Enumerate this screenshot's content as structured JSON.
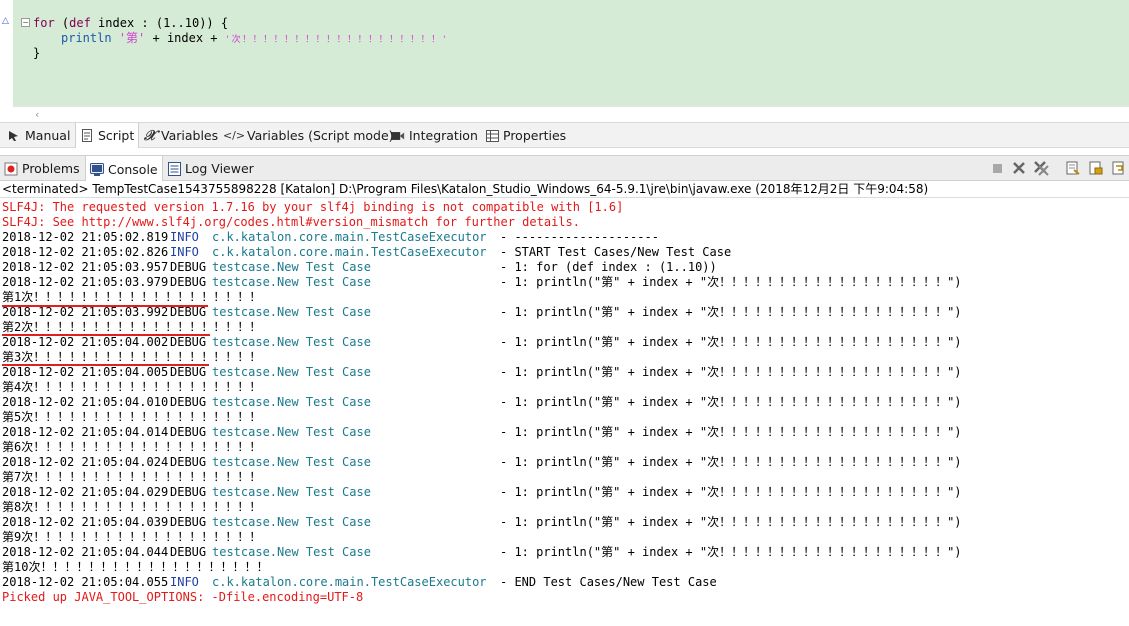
{
  "editor": {
    "line1": {
      "kw_for": "for",
      "p1": " (",
      "kw_def": "def",
      "p2": " index : (1..10)) {"
    },
    "line2": {
      "fn": "println",
      "sp": " ",
      "str1": "'第'",
      "mid": " + index + ",
      "str2": "'次！！！！！！！！！！！！！！！！！！！'"
    },
    "line3": "}"
  },
  "editor_tabs": [
    {
      "label": "Manual",
      "icon": "cursor-icon"
    },
    {
      "label": "Script",
      "icon": "script-icon"
    },
    {
      "label": "Variables",
      "icon": "variable-x-icon"
    },
    {
      "label": "Variables (Script mode)",
      "icon": "code-brackets-icon"
    },
    {
      "label": "Integration",
      "icon": "integration-icon"
    },
    {
      "label": "Properties",
      "icon": "table-icon"
    }
  ],
  "panel_tabs": [
    {
      "label": "Problems",
      "icon": "problems-icon"
    },
    {
      "label": "Console",
      "icon": "console-icon"
    },
    {
      "label": "Log Viewer",
      "icon": "log-viewer-icon"
    }
  ],
  "console_header": "<terminated> TempTestCase1543755898228 [Katalon] D:\\Program Files\\Katalon_Studio_Windows_64-5.9.1\\jre\\bin\\javaw.exe (2018年12月2日 下午9:04:58)",
  "console": {
    "warn1": "SLF4J: The requested version 1.7.16 by your slf4j binding is not compatible with [1.6]",
    "warn2": "SLF4J: See http://www.slf4j.org/codes.html#version_mismatch for further details.",
    "log": [
      {
        "ts": "2018-12-02 21:05:02.819",
        "level": "INFO",
        "src": "c.k.katalon.core.main.TestCaseExecutor",
        "msg": "- --------------------"
      },
      {
        "ts": "2018-12-02 21:05:02.826",
        "level": "INFO",
        "src": "c.k.katalon.core.main.TestCaseExecutor",
        "msg": "- START Test Cases/New Test Case"
      },
      {
        "ts": "2018-12-02 21:05:03.957",
        "level": "DEBUG",
        "src": "testcase.New Test Case",
        "msg": "- 1: for (def index : (1..10))"
      },
      {
        "ts": "2018-12-02 21:05:03.979",
        "level": "DEBUG",
        "src": "testcase.New Test Case",
        "msg": "- 1: println(\"第\" + index + \"次！！！！！！！！！！！！！！！！！！！\")"
      },
      {
        "out": "第1次！！！！！！！！！！！！！！！！！！！"
      },
      {
        "ts": "2018-12-02 21:05:03.992",
        "level": "DEBUG",
        "src": "testcase.New Test Case",
        "msg": "- 1: println(\"第\" + index + \"次！！！！！！！！！！！！！！！！！！！\")"
      },
      {
        "out": "第2次！！！！！！！！！！！！！！！！！！！"
      },
      {
        "ts": "2018-12-02 21:05:04.002",
        "level": "DEBUG",
        "src": "testcase.New Test Case",
        "msg": "- 1: println(\"第\" + index + \"次！！！！！！！！！！！！！！！！！！！\")"
      },
      {
        "out": "第3次！！！！！！！！！！！！！！！！！！！"
      },
      {
        "ts": "2018-12-02 21:05:04.005",
        "level": "DEBUG",
        "src": "testcase.New Test Case",
        "msg": "- 1: println(\"第\" + index + \"次！！！！！！！！！！！！！！！！！！！\")"
      },
      {
        "out": "第4次！！！！！！！！！！！！！！！！！！！"
      },
      {
        "ts": "2018-12-02 21:05:04.010",
        "level": "DEBUG",
        "src": "testcase.New Test Case",
        "msg": "- 1: println(\"第\" + index + \"次！！！！！！！！！！！！！！！！！！！\")"
      },
      {
        "out": "第5次！！！！！！！！！！！！！！！！！！！"
      },
      {
        "ts": "2018-12-02 21:05:04.014",
        "level": "DEBUG",
        "src": "testcase.New Test Case",
        "msg": "- 1: println(\"第\" + index + \"次！！！！！！！！！！！！！！！！！！！\")"
      },
      {
        "out": "第6次！！！！！！！！！！！！！！！！！！！"
      },
      {
        "ts": "2018-12-02 21:05:04.024",
        "level": "DEBUG",
        "src": "testcase.New Test Case",
        "msg": "- 1: println(\"第\" + index + \"次！！！！！！！！！！！！！！！！！！！\")"
      },
      {
        "out": "第7次！！！！！！！！！！！！！！！！！！！"
      },
      {
        "ts": "2018-12-02 21:05:04.029",
        "level": "DEBUG",
        "src": "testcase.New Test Case",
        "msg": "- 1: println(\"第\" + index + \"次！！！！！！！！！！！！！！！！！！！\")"
      },
      {
        "out": "第8次！！！！！！！！！！！！！！！！！！！"
      },
      {
        "ts": "2018-12-02 21:05:04.039",
        "level": "DEBUG",
        "src": "testcase.New Test Case",
        "msg": "- 1: println(\"第\" + index + \"次！！！！！！！！！！！！！！！！！！！\")"
      },
      {
        "out": "第9次！！！！！！！！！！！！！！！！！！！"
      },
      {
        "ts": "2018-12-02 21:05:04.044",
        "level": "DEBUG",
        "src": "testcase.New Test Case",
        "msg": "- 1: println(\"第\" + index + \"次！！！！！！！！！！！！！！！！！！！\")"
      },
      {
        "out": "第10次！！！！！！！！！！！！！！！！！！！"
      },
      {
        "ts": "2018-12-02 21:05:04.055",
        "level": "INFO",
        "src": "c.k.katalon.core.main.TestCaseExecutor",
        "msg": "- END Test Cases/New Test Case"
      }
    ],
    "footer": "Picked up JAVA_TOOL_OPTIONS: -Dfile.encoding=UTF-8"
  },
  "colors": {
    "editor_bg": "#d5ebd5",
    "error_red": "#e31919",
    "info_blue": "#1f3fa8",
    "source_teal": "#1b7a8c"
  }
}
